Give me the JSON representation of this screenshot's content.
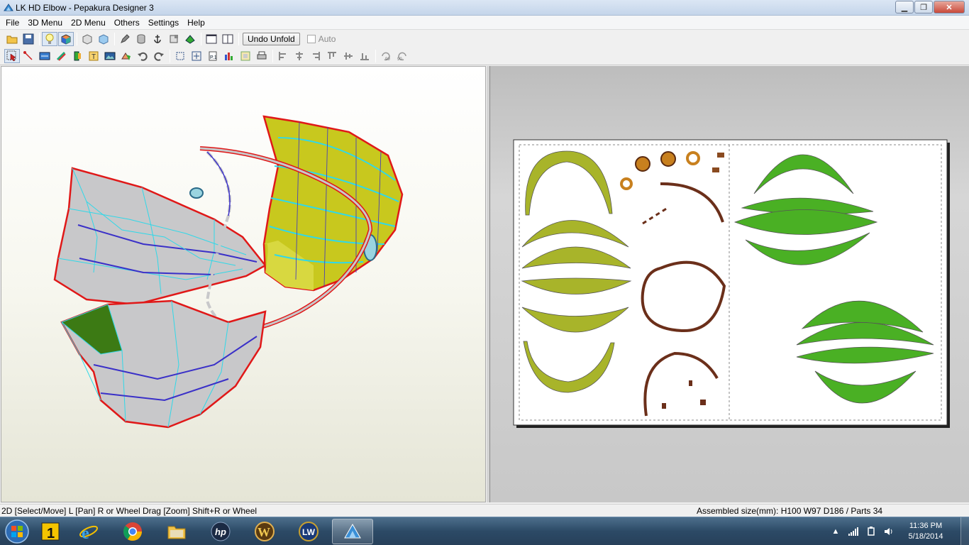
{
  "window": {
    "title": "LK HD Elbow - Pepakura Designer 3",
    "minimize_label": "▁",
    "maximize_label": "❐",
    "close_label": "✕"
  },
  "menubar": {
    "items": [
      "File",
      "3D Menu",
      "2D Menu",
      "Others",
      "Settings",
      "Help"
    ]
  },
  "toolbar1": {
    "undo_unfold_label": "Undo Unfold",
    "auto_label": "Auto",
    "auto_checked": false,
    "icons": [
      "open-icon",
      "save-icon",
      "lightbulb-icon",
      "color-cube-icon",
      "box-icon",
      "cube-icon",
      "pencil-icon",
      "cylinder-icon",
      "anchor-icon",
      "flap-icon",
      "join-icon",
      "single-view-icon",
      "dual-view-icon"
    ]
  },
  "toolbar2": {
    "icons": [
      "select-move-icon",
      "edge-edit-icon",
      "text-icon",
      "rotate-icon",
      "flap-icon",
      "text-box-icon",
      "image-icon",
      "join-parts-icon",
      "undo-icon",
      "redo-icon",
      "fit-icon",
      "zoom-fit-icon",
      "page-icon",
      "arrange-icon",
      "print-preview-icon",
      "print-icon",
      "align-left-icon",
      "align-center-icon",
      "align-right-icon",
      "align-top-icon",
      "align-middle-icon",
      "align-bottom-icon",
      "rotate-90-ccw-icon",
      "rotate-90-cw-icon"
    ]
  },
  "status": {
    "left": "2D [Select/Move] L [Pan] R or Wheel Drag [Zoom] Shift+R or Wheel",
    "right": "Assembled size(mm): H100 W97 D186 / Parts 34"
  },
  "taskbar": {
    "apps": [
      "start-orb",
      "app-1",
      "internet-explorer",
      "chrome",
      "file-explorer",
      "hp-app",
      "warcraft-app",
      "lw-app",
      "pepakura-app"
    ],
    "time": "11:36 PM",
    "date": "5/18/2014"
  },
  "colors": {
    "model_gray": "#c8c8ca",
    "model_yellow": "#c8c81e",
    "model_green": "#3c7a14",
    "cut_line": "#e01818",
    "edge_line": "#30d8e8",
    "part_olive": "#a8b42a",
    "part_green": "#4ab024",
    "part_brown": "#6b2f1a"
  }
}
